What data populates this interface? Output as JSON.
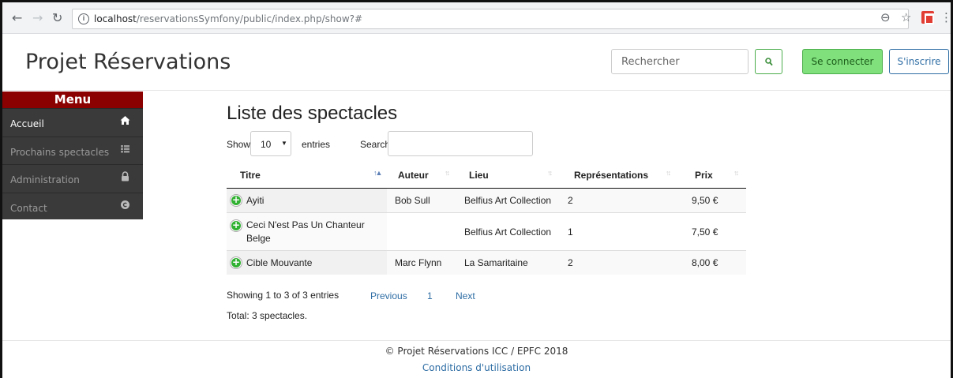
{
  "browser": {
    "url_host": "localhost",
    "url_path": "/reservationsSymfony/public/index.php/show?#"
  },
  "header": {
    "brand": "Projet Réservations",
    "search_placeholder": "Rechercher",
    "login_label": "Se connecter",
    "signup_label": "S'inscrire"
  },
  "sidebar": {
    "title": "Menu",
    "items": [
      {
        "label": "Accueil",
        "icon": "home-icon"
      },
      {
        "label": "Prochains spectacles",
        "icon": "list-icon"
      },
      {
        "label": "Administration",
        "icon": "lock-icon"
      },
      {
        "label": "Contact",
        "icon": "copyright-icon"
      }
    ]
  },
  "main": {
    "title": "Liste des spectacles",
    "length_show": "Show",
    "length_value": "10",
    "length_entries": "entries",
    "search_label": "Search:",
    "columns": [
      "Titre",
      "Auteur",
      "Lieu",
      "Représentations",
      "Prix"
    ],
    "rows": [
      {
        "titre": "Ayiti",
        "auteur": "Bob Sull",
        "lieu": "Belfius Art Collection",
        "representations": "2",
        "prix": "9,50 €"
      },
      {
        "titre": "Ceci N'est Pas Un Chanteur Belge",
        "auteur": "",
        "lieu": "Belfius Art Collection",
        "representations": "1",
        "prix": "7,50 €"
      },
      {
        "titre": "Cible Mouvante",
        "auteur": "Marc Flynn",
        "lieu": "La Samaritaine",
        "representations": "2",
        "prix": "8,00 €"
      }
    ],
    "info": "Showing 1 to 3 of 3 entries",
    "pagination": {
      "previous": "Previous",
      "page": "1",
      "next": "Next"
    },
    "total": "Total: 3 spectacles."
  },
  "footer": {
    "copyright": "© Projet Réservations ICC / EPFC 2018",
    "terms": "Conditions d'utilisation"
  },
  "colors": {
    "menu_header": "#8b0000",
    "sidebar_bg": "#3a3a3a",
    "login_bg": "#7fe07c",
    "link": "#2e6da4"
  }
}
